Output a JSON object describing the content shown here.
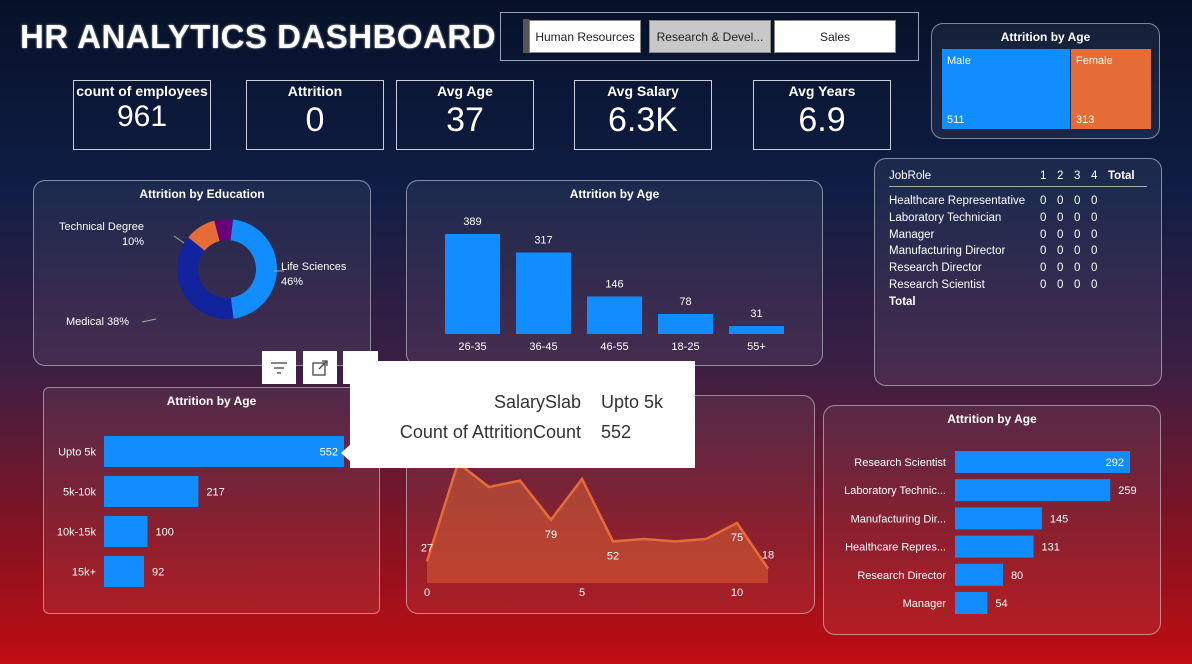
{
  "header": {
    "title": "HR ANALYTICS DASHBOARD"
  },
  "slicer": {
    "options": [
      "Human Resources",
      "Research & Devel...",
      "Sales"
    ],
    "selected": "Research & Devel..."
  },
  "kpis": [
    {
      "label": "count of employees",
      "value": "961"
    },
    {
      "label": "Attrition",
      "value": "0"
    },
    {
      "label": "Avg Age",
      "value": "37"
    },
    {
      "label": "Avg Salary",
      "value": "6.3K"
    },
    {
      "label": "Avg Years",
      "value": "6.9"
    }
  ],
  "gender_card": {
    "title": "Attrition by Age",
    "male_label": "Male",
    "male_value": "511",
    "male_color": "#118dff",
    "female_label": "Female",
    "female_value": "313",
    "female_color": "#e66c37"
  },
  "job_table": {
    "headers": [
      "JobRole",
      "1",
      "2",
      "3",
      "4",
      "Total"
    ],
    "rows": [
      {
        "role": "Healthcare Representative",
        "v": [
          "0",
          "0",
          "0",
          "0"
        ]
      },
      {
        "role": "Laboratory Technician",
        "v": [
          "0",
          "0",
          "0",
          "0"
        ]
      },
      {
        "role": "Manager",
        "v": [
          "0",
          "0",
          "0",
          "0"
        ]
      },
      {
        "role": "Manufacturing Director",
        "v": [
          "0",
          "0",
          "0",
          "0"
        ]
      },
      {
        "role": "Research Director",
        "v": [
          "0",
          "0",
          "0",
          "0"
        ]
      },
      {
        "role": "Research Scientist",
        "v": [
          "0",
          "0",
          "0",
          "0"
        ]
      }
    ],
    "total_label": "Total"
  },
  "tooltip": {
    "k1": "SalarySlab",
    "v1": "Upto 5k",
    "k2": "Count of AttritionCount",
    "v2": "552"
  },
  "chart_data": [
    {
      "type": "pie",
      "title": "Attrition by Education",
      "slices": [
        {
          "label": "Life Sciences",
          "pct": "46%",
          "value": 46,
          "color": "#118dff"
        },
        {
          "label": "Medical",
          "pct": "38%",
          "value": 38,
          "color": "#12239e"
        },
        {
          "label": "Technical Degree",
          "pct": "10%",
          "value": 10,
          "color": "#e66c37"
        },
        {
          "label": "",
          "pct": "",
          "value": 6,
          "color": "#6b007b"
        }
      ]
    },
    {
      "type": "bar",
      "title": "Attrition by Age",
      "categories": [
        "26-35",
        "36-45",
        "46-55",
        "18-25",
        "55+"
      ],
      "values": [
        389,
        317,
        146,
        78,
        31
      ],
      "color": "#118dff"
    },
    {
      "type": "bar",
      "orientation": "horizontal",
      "title": "Attrition by Age",
      "categories": [
        "Upto 5k",
        "5k-10k",
        "10k-15k",
        "15k+"
      ],
      "values": [
        552,
        217,
        100,
        92
      ],
      "color": "#118dff"
    },
    {
      "type": "area",
      "x_ticks": [
        "0",
        "5",
        "10"
      ],
      "labels": [
        {
          "x": 0,
          "y": 27
        },
        {
          "x": 4,
          "y": 79
        },
        {
          "x": 6,
          "y": 52
        },
        {
          "x": 10,
          "y": 75
        },
        {
          "x": 11,
          "y": 18
        }
      ],
      "x": [
        0,
        1,
        2,
        3,
        4,
        5,
        6,
        7,
        8,
        9,
        10,
        11
      ],
      "y": [
        27,
        150,
        120,
        128,
        79,
        130,
        52,
        55,
        52,
        55,
        75,
        18
      ],
      "color": "#e66c37"
    },
    {
      "type": "bar",
      "orientation": "horizontal",
      "title": "Attrition by Age",
      "categories": [
        "Research Scientist",
        "Laboratory Technic...",
        "Manufacturing Dir...",
        "Healthcare Repres...",
        "Research Director",
        "Manager"
      ],
      "values": [
        292,
        259,
        145,
        131,
        80,
        54
      ],
      "color": "#118dff"
    }
  ]
}
